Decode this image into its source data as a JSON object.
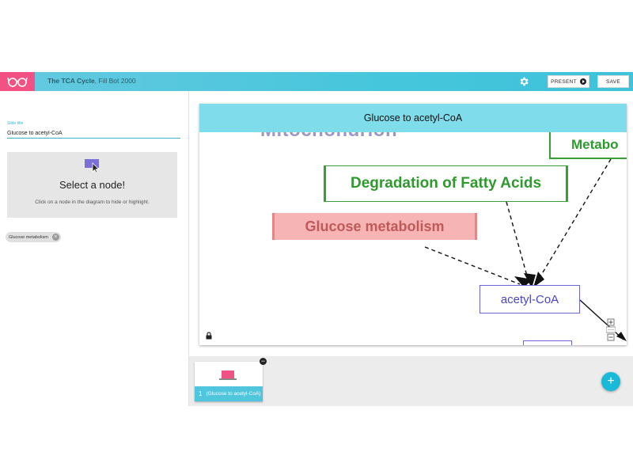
{
  "app": {
    "title_bold": "The TCA Cycle",
    "title_rest": ", Fill Bot 2000",
    "logo_icon": "glasses-icon",
    "settings_icon": "gear-icon",
    "present_label": "PRESENT",
    "save_label": "SAVE",
    "accent": "#46c6dc",
    "logo_bg": "#f25283"
  },
  "editor": {
    "slide_title_label": "Slide title",
    "slide_title_value": "Glucose to acetyl-CoA",
    "select_card": {
      "heading": "Select a node!",
      "hint": "Click on a node in the diagram to hide or highlight.",
      "icon": "cursor-select-icon"
    },
    "chips": [
      {
        "label": "Glucose metabolism",
        "remove_icon": "close-icon"
      }
    ]
  },
  "slide": {
    "header": "Glucose to acetyl-CoA",
    "faded_label": "Mitochondrion",
    "nodes": {
      "metabo": "Metabo",
      "fatty": "Degradation of Fatty Acids",
      "glucose": "Glucose metabolism",
      "acetyl": "acetyl-CoA"
    },
    "colors": {
      "header_bg": "#7fdcea",
      "green": "#2e9a2e",
      "highlight_bg": "#f7b4b4",
      "purple": "#4a45c8"
    },
    "lock_icon": "lock-icon",
    "zoom_icons": [
      "zoom-in-icon",
      "zoom-reset-icon",
      "zoom-out-icon"
    ]
  },
  "thumbnails": [
    {
      "number": "1",
      "label": "(Glucose to acetyl-CoA)"
    }
  ],
  "add_slide_label": "+",
  "remove_label": "−"
}
